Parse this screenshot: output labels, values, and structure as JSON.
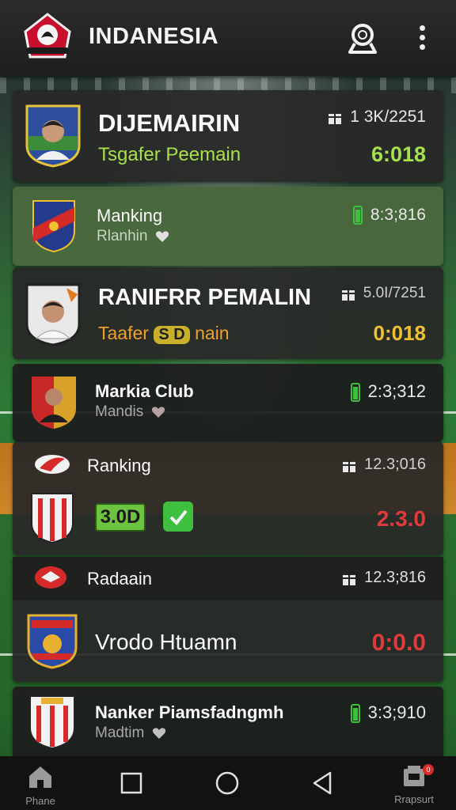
{
  "header": {
    "title": "INDANESIA"
  },
  "cards": [
    {
      "title": "DIJEMAIRIN",
      "subtitle": "Tsgafer Peemain",
      "stat": "1 3K/2251",
      "score": "6:018"
    },
    {
      "title": "Manking",
      "subtitle": "Rlanhin",
      "stat": "8:3;816"
    },
    {
      "title": "RANIFRR PEMALIN",
      "subtitle_pre": "Taafer",
      "subtitle_badge": "S D",
      "subtitle_post": "nain",
      "stat": "5.0I/7251",
      "score": "0:018"
    },
    {
      "title": "Markia Club",
      "subtitle": "Mandis",
      "stat": "2:3;312"
    },
    {
      "title": "Ranking",
      "stat": "12.3;016",
      "pill": "3.0D",
      "score": "2.3.0"
    },
    {
      "title": "Radaain",
      "stat": "12.3;816"
    },
    {
      "title": "Vrodo Htuamn",
      "score": "0:0.0"
    },
    {
      "title": "Nanker Piamsfadngmh",
      "subtitle": "Madtim",
      "stat": "3:3;910"
    }
  ],
  "nav": [
    {
      "label": "Phane",
      "icon": "home-icon"
    },
    {
      "label": "",
      "icon": "square-icon"
    },
    {
      "label": "",
      "icon": "circle-icon"
    },
    {
      "label": "",
      "icon": "back-triangle-icon"
    },
    {
      "label": "Rrapsurt",
      "icon": "inbox-icon",
      "badge": "0"
    }
  ],
  "colors": {
    "lime": "#a6e04a",
    "orange": "#f0a028",
    "red": "#e03a3a",
    "green_icon": "#3fbf3f"
  }
}
